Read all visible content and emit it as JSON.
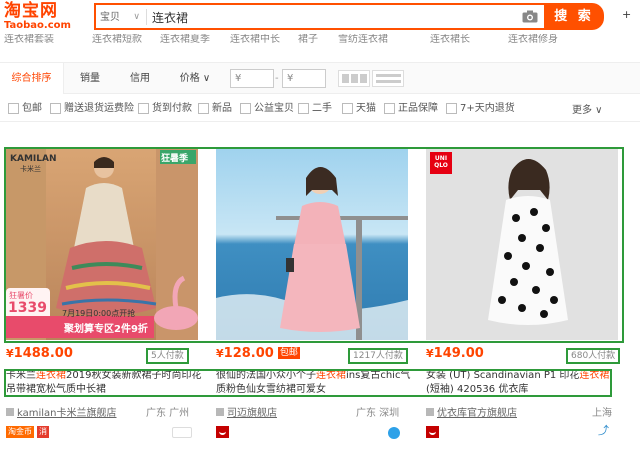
{
  "header": {
    "logo_text": "淘宝网",
    "logo_sub": "Taobao.com",
    "search_category": "宝贝",
    "search_value": "连衣裙",
    "search_button": "搜 索",
    "right_text": "+"
  },
  "hint_row": [
    "连衣裙套装",
    "连衣裙短款",
    "连衣裙夏季",
    "连衣裙中长",
    "裙子",
    "雪纺连衣裙",
    "连衣裙长",
    "连衣裙修身"
  ],
  "sort_bar": {
    "tabs": [
      "综合排序",
      "销量",
      "信用",
      "价格 ∨"
    ],
    "price_from_placeholder": "¥",
    "price_to_placeholder": "¥",
    "dash": "-"
  },
  "filters": [
    "包邮",
    "赠送退货运费险",
    "货到付款",
    "新品",
    "公益宝贝",
    "二手",
    "天猫",
    "正品保障",
    "7+天内退货"
  ],
  "more_label": "更多 ∨",
  "colors": {
    "accent": "#ff4400",
    "highlight": "#2e9a3a"
  },
  "products": [
    {
      "price": "1488.00",
      "currency": "¥",
      "baoyou": "",
      "sales": "5人付款",
      "title_pre": "卡米兰",
      "title_em": "连衣裙",
      "title_post": "2019秋女装新款裙子时尚印花吊带裙宽松气质中长裙",
      "shop": "kamilan卡米兰旗舰店",
      "location": "广东 广州",
      "image_overlay": {
        "brand": "KAMILAN",
        "brand_sub": "卡米兰",
        "corner_tag": "狂暑季",
        "price_label": "狂暑价",
        "price_value": "1339",
        "date_text": "7月19日0:00点开抢",
        "promo_text": "聚划算专区2件9折"
      },
      "tags": [
        "淘金币",
        "消"
      ]
    },
    {
      "price": "128.00",
      "currency": "¥",
      "baoyou": "包邮",
      "sales": "1217人付款",
      "title_pre": "很仙的法国小众小个子",
      "title_em": "连衣裙",
      "title_post": "ins复古chic气质粉色仙女雪纺裙可爱女",
      "shop": "司迈旗舰店",
      "location": "广东 深圳",
      "tags": []
    },
    {
      "price": "149.00",
      "currency": "¥",
      "baoyou": "",
      "sales": "680人付款",
      "title_pre": "女装 (UT) Scandinavian P1 印花",
      "title_em": "连衣裙",
      "title_post": "(短袖) 420536 优衣库",
      "shop": "优衣库官方旗舰店",
      "location": "上海",
      "image_overlay": {
        "brand": "UNI QLO"
      },
      "tags": []
    }
  ]
}
